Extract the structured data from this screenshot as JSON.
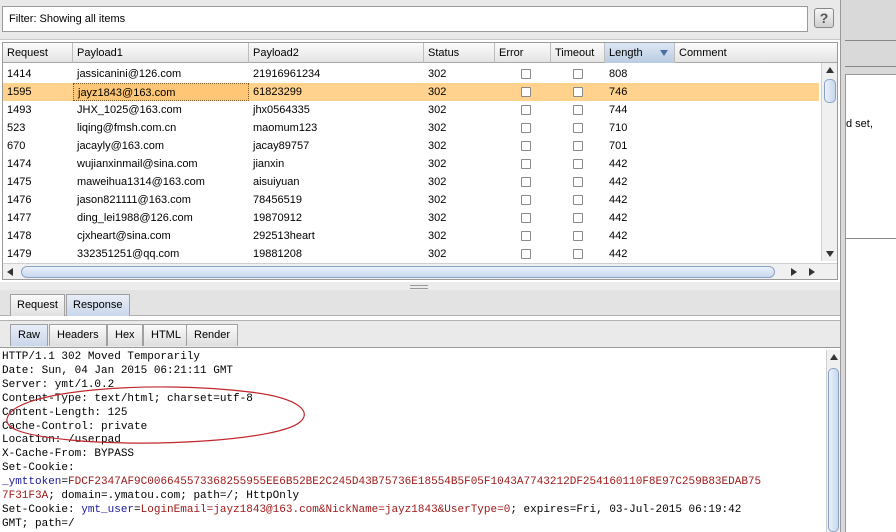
{
  "filter": {
    "label": "Filter:  Showing all items",
    "help": "?"
  },
  "table": {
    "columns": [
      "Request",
      "Payload1",
      "Payload2",
      "Status",
      "Error",
      "Timeout",
      "Length",
      "Comment"
    ],
    "sorted_column": "Length",
    "rows": [
      {
        "request": "1414",
        "payload1": "jassicanini@126.com",
        "payload2": "21916961234",
        "status": "302",
        "error": false,
        "timeout": false,
        "length": "808",
        "comment": ""
      },
      {
        "request": "1595",
        "payload1": "jayz1843@163.com",
        "payload2": "61823299",
        "status": "302",
        "error": false,
        "timeout": false,
        "length": "746",
        "comment": "",
        "selected": true
      },
      {
        "request": "1493",
        "payload1": "JHX_1025@163.com",
        "payload2": "jhx0564335",
        "status": "302",
        "error": false,
        "timeout": false,
        "length": "744",
        "comment": ""
      },
      {
        "request": "523",
        "payload1": "liqing@fmsh.com.cn",
        "payload2": "maomum123",
        "status": "302",
        "error": false,
        "timeout": false,
        "length": "710",
        "comment": ""
      },
      {
        "request": "670",
        "payload1": "jacayly@163.com",
        "payload2": "jacay89757",
        "status": "302",
        "error": false,
        "timeout": false,
        "length": "701",
        "comment": ""
      },
      {
        "request": "1474",
        "payload1": "wujianxinmail@sina.com",
        "payload2": "jianxin",
        "status": "302",
        "error": false,
        "timeout": false,
        "length": "442",
        "comment": ""
      },
      {
        "request": "1475",
        "payload1": "maweihua1314@163.com",
        "payload2": "aisuiyuan",
        "status": "302",
        "error": false,
        "timeout": false,
        "length": "442",
        "comment": ""
      },
      {
        "request": "1476",
        "payload1": "jason821111@163.com",
        "payload2": "78456519",
        "status": "302",
        "error": false,
        "timeout": false,
        "length": "442",
        "comment": ""
      },
      {
        "request": "1477",
        "payload1": "ding_lei1988@126.com",
        "payload2": "19870912",
        "status": "302",
        "error": false,
        "timeout": false,
        "length": "442",
        "comment": ""
      },
      {
        "request": "1478",
        "payload1": "cjxheart@sina.com",
        "payload2": "292513heart",
        "status": "302",
        "error": false,
        "timeout": false,
        "length": "442",
        "comment": ""
      },
      {
        "request": "1479",
        "payload1": "332351251@qq.com",
        "payload2": "19881208",
        "status": "302",
        "error": false,
        "timeout": false,
        "length": "442",
        "comment": ""
      }
    ]
  },
  "tabs_top": {
    "request": "Request",
    "response": "Response",
    "active": "Response"
  },
  "tabs_view": {
    "raw": "Raw",
    "headers": "Headers",
    "hex": "Hex",
    "html": "HTML",
    "render": "Render",
    "active": "Raw"
  },
  "response_raw": {
    "lines": [
      "HTTP/1.1 302 Moved Temporarily",
      "Date: Sun, 04 Jan 2015 06:21:11 GMT",
      "Server: ymt/1.0.2",
      "Content-Type: text/html; charset=utf-8",
      "Content-Length: 125",
      "Cache-Control: private",
      "Location: /userpad",
      "X-Cache-From: BYPASS",
      "Set-Cookie:"
    ],
    "cookie1_name": "_ymttoken",
    "cookie1_value": "FDCF2347AF9C006645573368255955EE6B52BE2C245D43B75736E18554B5F05F1043A7743212DF254160110F8E97C259B83EDAB75",
    "cookie1_value_cont": "7F31F3A",
    "cookie1_attrs": "; domain=.ymatou.com; path=/; HttpOnly",
    "set_cookie_label": "Set-Cookie: ",
    "cookie2_name": "ymt_user",
    "cookie2_value": "LoginEmail=jayz1843@163.com&NickName=jayz1843&UserType=0",
    "cookie2_attrs": "; expires=Fri, 03-Jul-2015 06:19:42",
    "last_line": "GMT; path=/"
  },
  "side_text": "d set,",
  "colors": {
    "selected_row": "#ffd28e",
    "annotation": "#c0282d",
    "cookie_name": "#1a1a9a",
    "cookie_value": "#a01a1a"
  }
}
